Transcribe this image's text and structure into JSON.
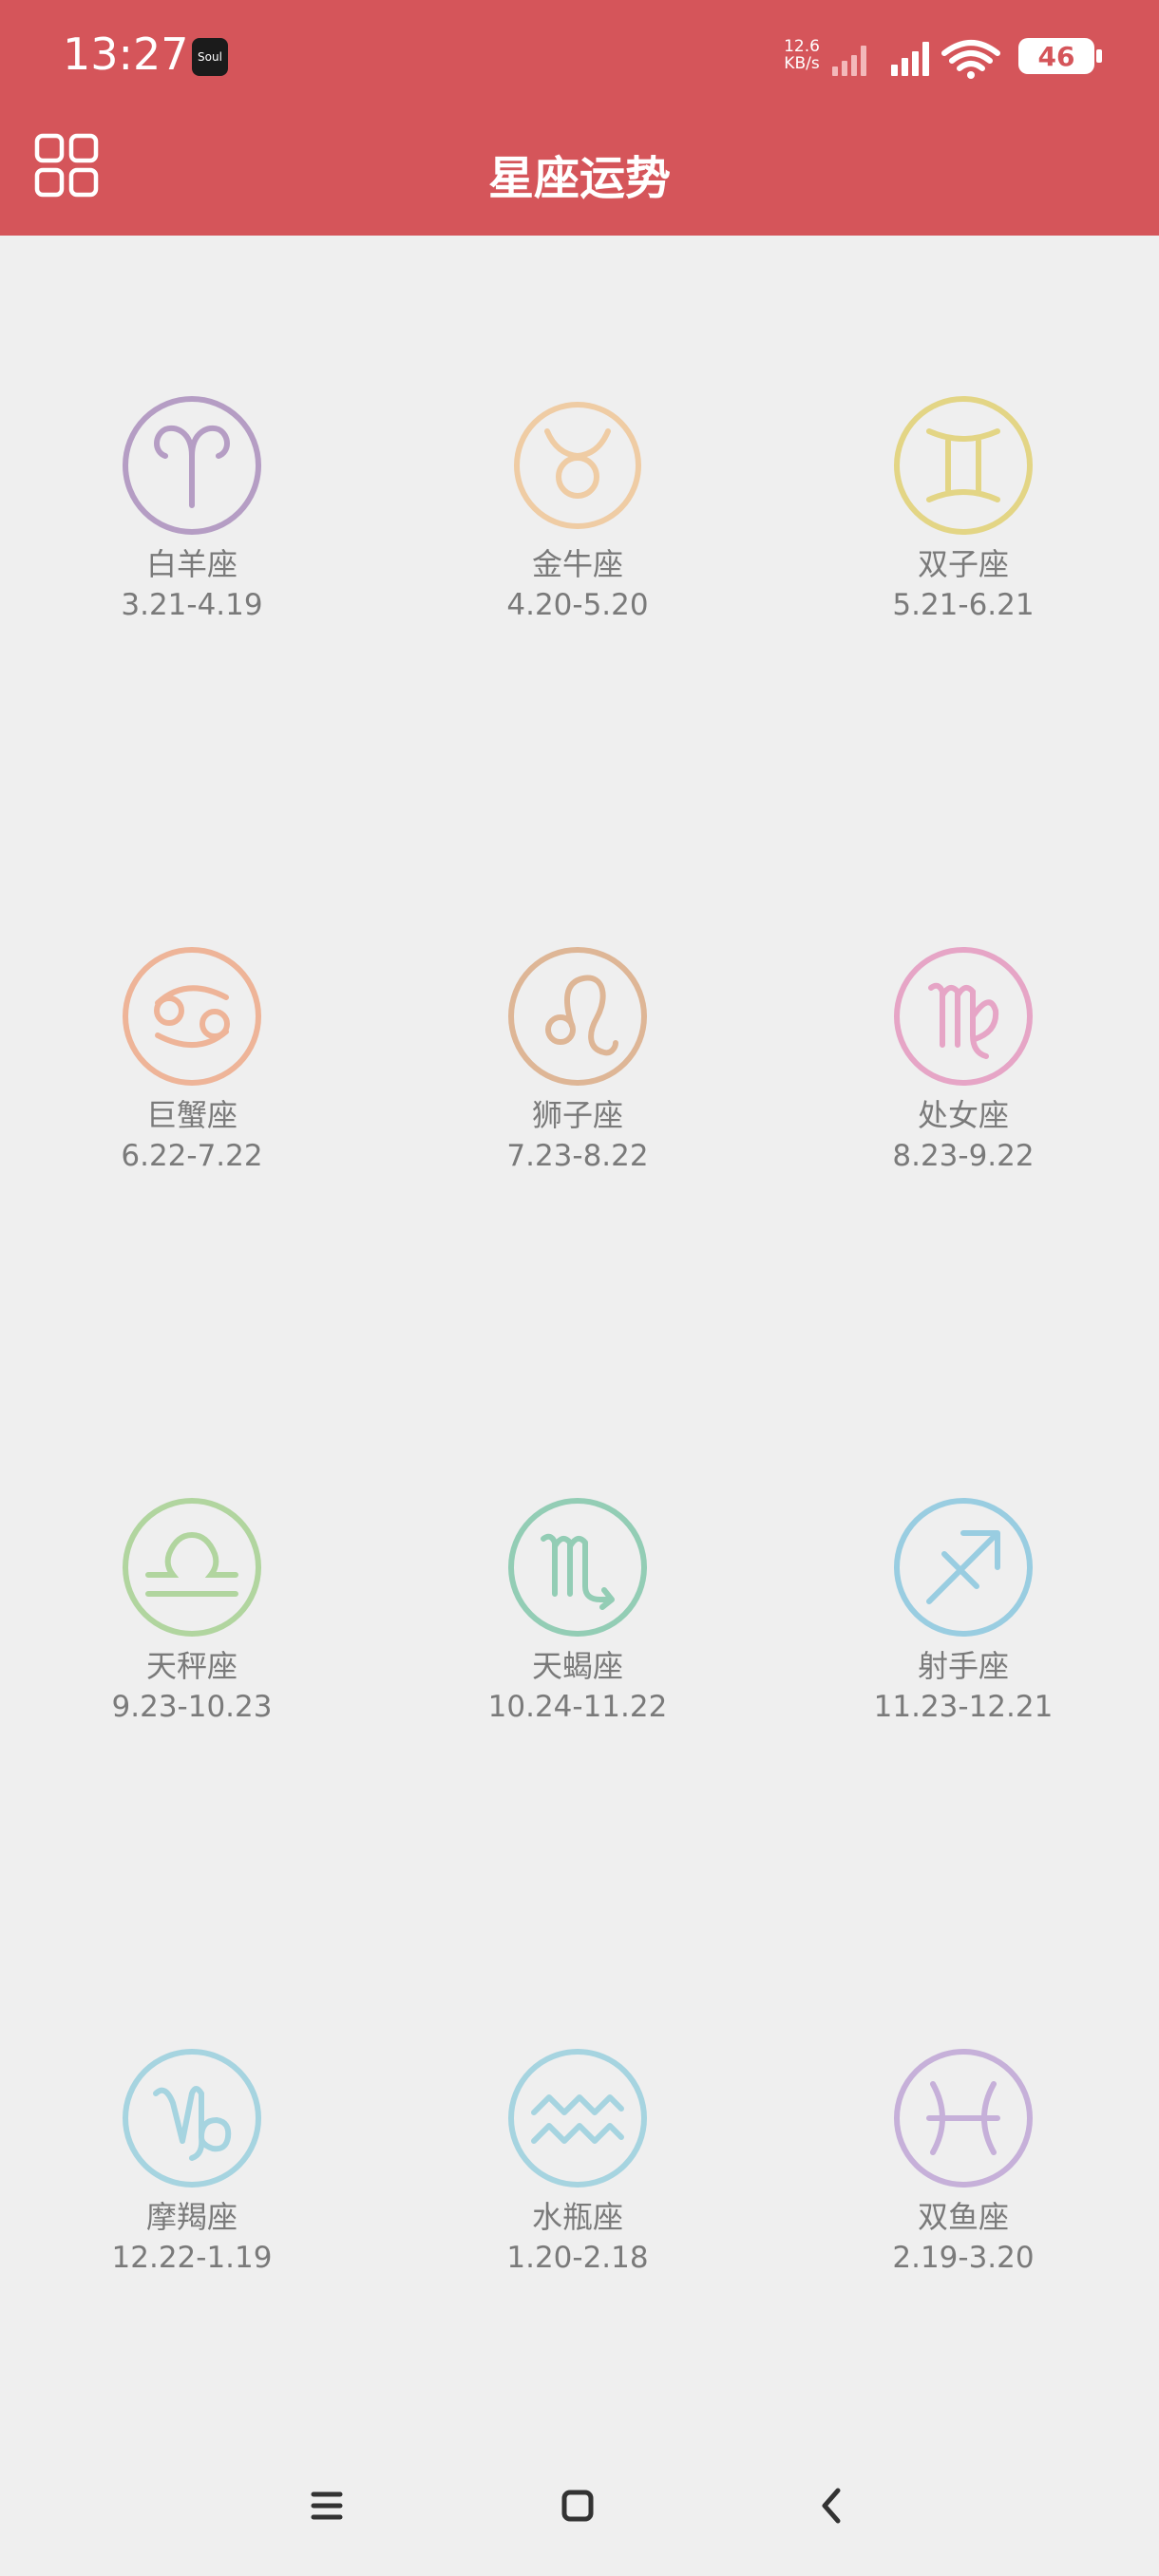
{
  "status": {
    "time": "13:27",
    "soul_badge": "Soul",
    "net_speed_value": "12.6",
    "net_speed_unit": "KB/s",
    "battery": "46"
  },
  "header": {
    "title": "星座运势",
    "menu_icon": "grid-icon"
  },
  "colors": {
    "header": "#d5555a",
    "background": "#efefef",
    "label_text": "#7a7a7a"
  },
  "signs": [
    {
      "name": "白羊座",
      "dates": "3.21-4.19",
      "icon": "aries-icon",
      "color": "#b59dc4"
    },
    {
      "name": "金牛座",
      "dates": "4.20-5.20",
      "icon": "taurus-icon",
      "color": "#efcca4"
    },
    {
      "name": "双子座",
      "dates": "5.21-6.21",
      "icon": "gemini-icon",
      "color": "#e3d585"
    },
    {
      "name": "巨蟹座",
      "dates": "6.22-7.22",
      "icon": "cancer-icon",
      "color": "#eeb498"
    },
    {
      "name": "狮子座",
      "dates": "7.23-8.22",
      "icon": "leo-icon",
      "color": "#deb696"
    },
    {
      "name": "处女座",
      "dates": "8.23-9.22",
      "icon": "virgo-icon",
      "color": "#e6a5c6"
    },
    {
      "name": "天秤座",
      "dates": "9.23-10.23",
      "icon": "libra-icon",
      "color": "#b1d59f"
    },
    {
      "name": "天蝎座",
      "dates": "10.24-11.22",
      "icon": "scorpio-icon",
      "color": "#93cdb5"
    },
    {
      "name": "射手座",
      "dates": "11.23-12.21",
      "icon": "sagittarius-icon",
      "color": "#99cde1"
    },
    {
      "name": "摩羯座",
      "dates": "12.22-1.19",
      "icon": "capricorn-icon",
      "color": "#a6d4e0"
    },
    {
      "name": "水瓶座",
      "dates": "1.20-2.18",
      "icon": "aquarius-icon",
      "color": "#a6d4e0"
    },
    {
      "name": "双鱼座",
      "dates": "2.19-3.20",
      "icon": "pisces-icon",
      "color": "#c6b0d9"
    }
  ],
  "navbar": {
    "menu": "hamburger-icon",
    "home": "home-square-icon",
    "back": "back-chevron-icon"
  }
}
